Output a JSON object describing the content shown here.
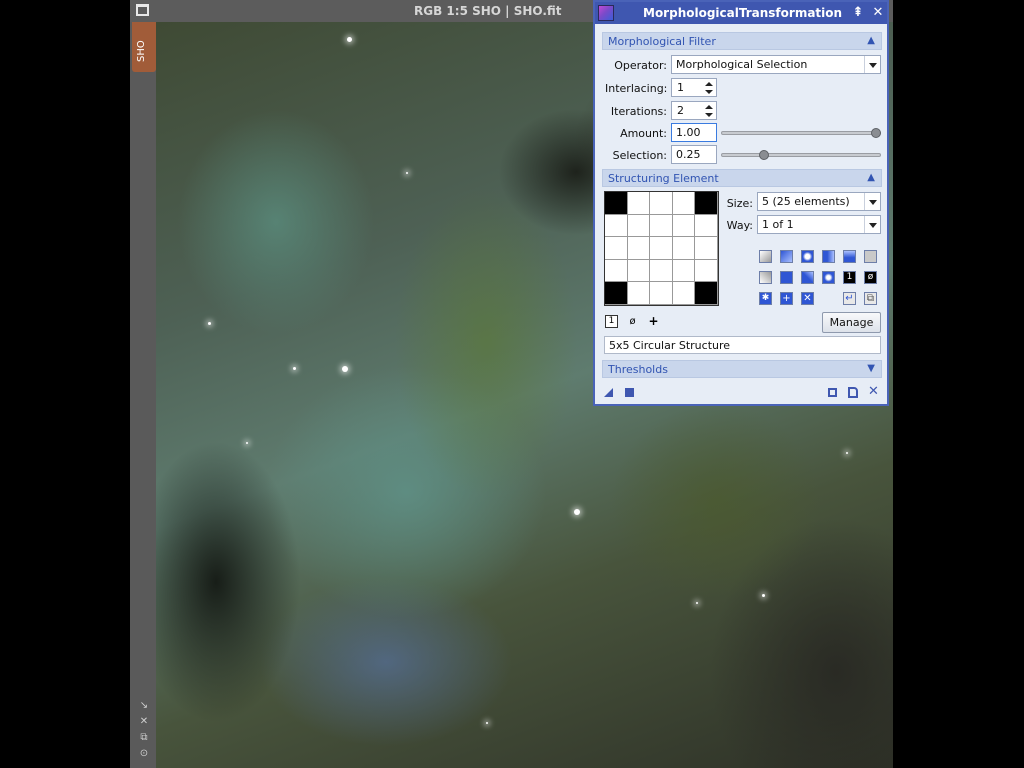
{
  "image_window": {
    "title": "RGB 1:5 SHO | SHO.fit",
    "side_tab": "SHO",
    "side_tools": [
      "fit-icon",
      "zoom-icon",
      "copy-icon",
      "settings-icon"
    ]
  },
  "dialog": {
    "title": "MorphologicalTransformation",
    "morph_filter": {
      "header": "Morphological Filter",
      "operator_label": "Operator:",
      "operator_value": "Morphological Selection",
      "interlacing_label": "Interlacing:",
      "interlacing_value": "1",
      "iterations_label": "Iterations:",
      "iterations_value": "2",
      "amount_label": "Amount:",
      "amount_value": "1.00",
      "amount_level": 1.0,
      "selection_label": "Selection:",
      "selection_value": "0.25",
      "selection_level": 0.25
    },
    "structuring": {
      "header": "Structuring Element",
      "size_label": "Size:",
      "size_value": "5  (25 elements)",
      "way_label": "Way:",
      "way_value": "1 of 1",
      "grid": [
        [
          1,
          0,
          0,
          0,
          1
        ],
        [
          0,
          0,
          0,
          0,
          0
        ],
        [
          0,
          0,
          0,
          0,
          0
        ],
        [
          0,
          0,
          0,
          0,
          0
        ],
        [
          1,
          0,
          0,
          0,
          1
        ]
      ],
      "bottom_tools": [
        "1",
        "ø",
        "+"
      ],
      "manage_label": "Manage",
      "structure_name": "5x5 Circular Structure"
    },
    "thresholds": {
      "header": "Thresholds"
    }
  },
  "colors": {
    "dialog_border": "#4a63b8",
    "section_text": "#3154b2",
    "section_bg": "#c9d6ec"
  }
}
